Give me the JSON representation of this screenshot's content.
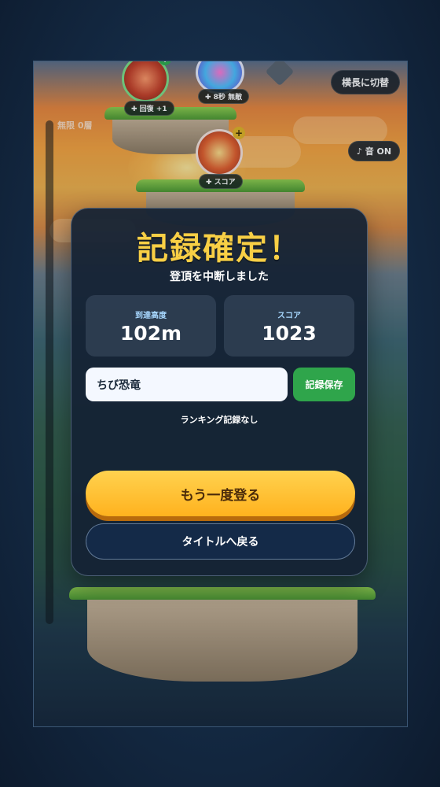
{
  "hud": {
    "depth_label": "無限 0層",
    "landscape_button": "横長に切替",
    "sound_button": "♪ 音 ON"
  },
  "items": [
    {
      "name": "health-orb",
      "tag": "✚ 回復 +1"
    },
    {
      "name": "invincible-orb",
      "tag": "✚ 8秒 無敵"
    },
    {
      "name": "score-orb",
      "tag": "✚ スコア"
    }
  ],
  "result": {
    "title": "記録確定！",
    "subtitle": "登頂を中断しました",
    "height_label": "到達高度",
    "height_value": "102m",
    "score_label": "スコア",
    "score_value": "1023",
    "name_value": "ちび恐竜",
    "save_button": "記録保存",
    "ranking_note": "ランキング記録なし",
    "retry_button": "もう一度登る",
    "title_button": "タイトルへ戻る"
  },
  "colors": {
    "title": "#f8cf45",
    "retry": "#ffc135",
    "save": "#2fa54b",
    "panel": "#142234"
  }
}
